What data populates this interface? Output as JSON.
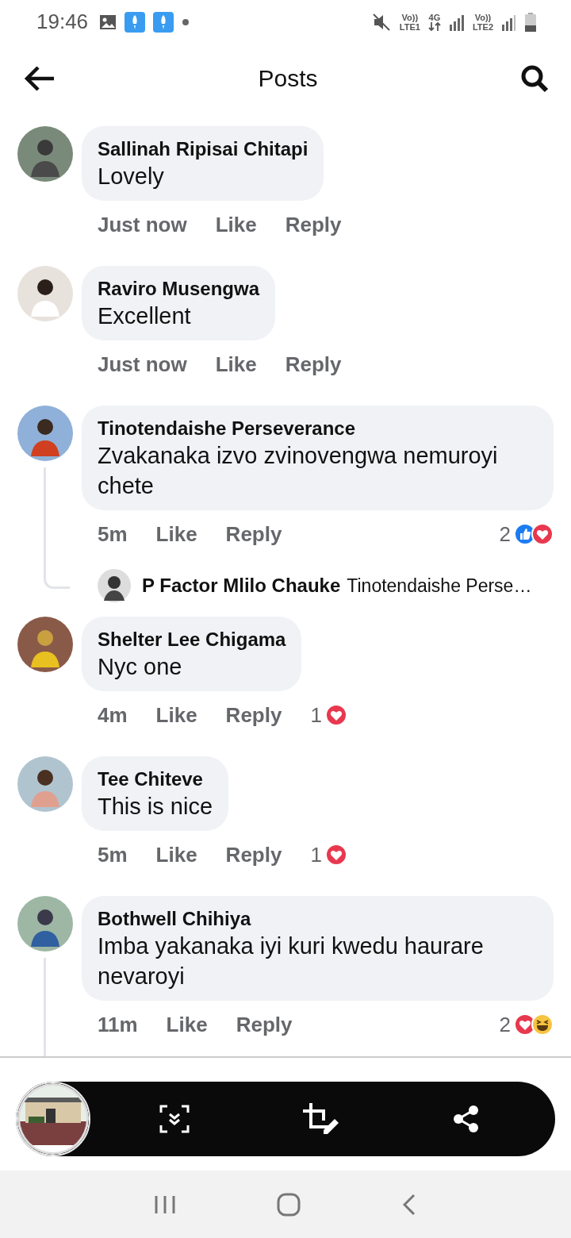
{
  "status_bar": {
    "time": "19:46",
    "sim1": [
      "Vo))",
      "LTE1"
    ],
    "network": "4G",
    "sim2": [
      "Vo))",
      "LTE2"
    ]
  },
  "header": {
    "title": "Posts"
  },
  "comments": [
    {
      "author": "Sallinah Ripisai Chitapi",
      "text": "Lovely",
      "time": "Just now",
      "like": "Like",
      "reply": "Reply",
      "thread": false
    },
    {
      "author": "Raviro Musengwa",
      "text": "Excellent",
      "time": "Just now",
      "like": "Like",
      "reply": "Reply",
      "thread": false
    },
    {
      "author": "Tinotendaishe Perseverance",
      "text": "Zvakanaka izvo zvinovengwa nemuroyi chete",
      "time": "5m",
      "like": "Like",
      "reply": "Reply",
      "thread": true,
      "reaction_count": "2",
      "reactions": [
        {
          "kind": "like"
        },
        {
          "kind": "love"
        }
      ],
      "reply_preview": {
        "author": "P Factor Mlilo Chauke",
        "text": "Tinotendaishe Perse…"
      }
    },
    {
      "author": "Shelter Lee Chigama",
      "text": "Nyc one",
      "time": "4m",
      "like": "Like",
      "reply": "Reply",
      "thread": false,
      "reaction_count": "1",
      "reactions": [
        {
          "kind": "love"
        }
      ]
    },
    {
      "author": "Tee Chiteve",
      "text": "This is nice",
      "time": "5m",
      "like": "Like",
      "reply": "Reply",
      "thread": false,
      "reaction_count": "1",
      "reactions": [
        {
          "kind": "love"
        }
      ]
    },
    {
      "author": "Bothwell Chihiya",
      "text": "Imba yakanaka iyi kuri kwedu haurare nevaroyi",
      "time": "11m",
      "like": "Like",
      "reply": "Reply",
      "thread": true,
      "reaction_count": "2",
      "reactions": [
        {
          "kind": "love"
        },
        {
          "kind": "haha"
        }
      ]
    }
  ]
}
